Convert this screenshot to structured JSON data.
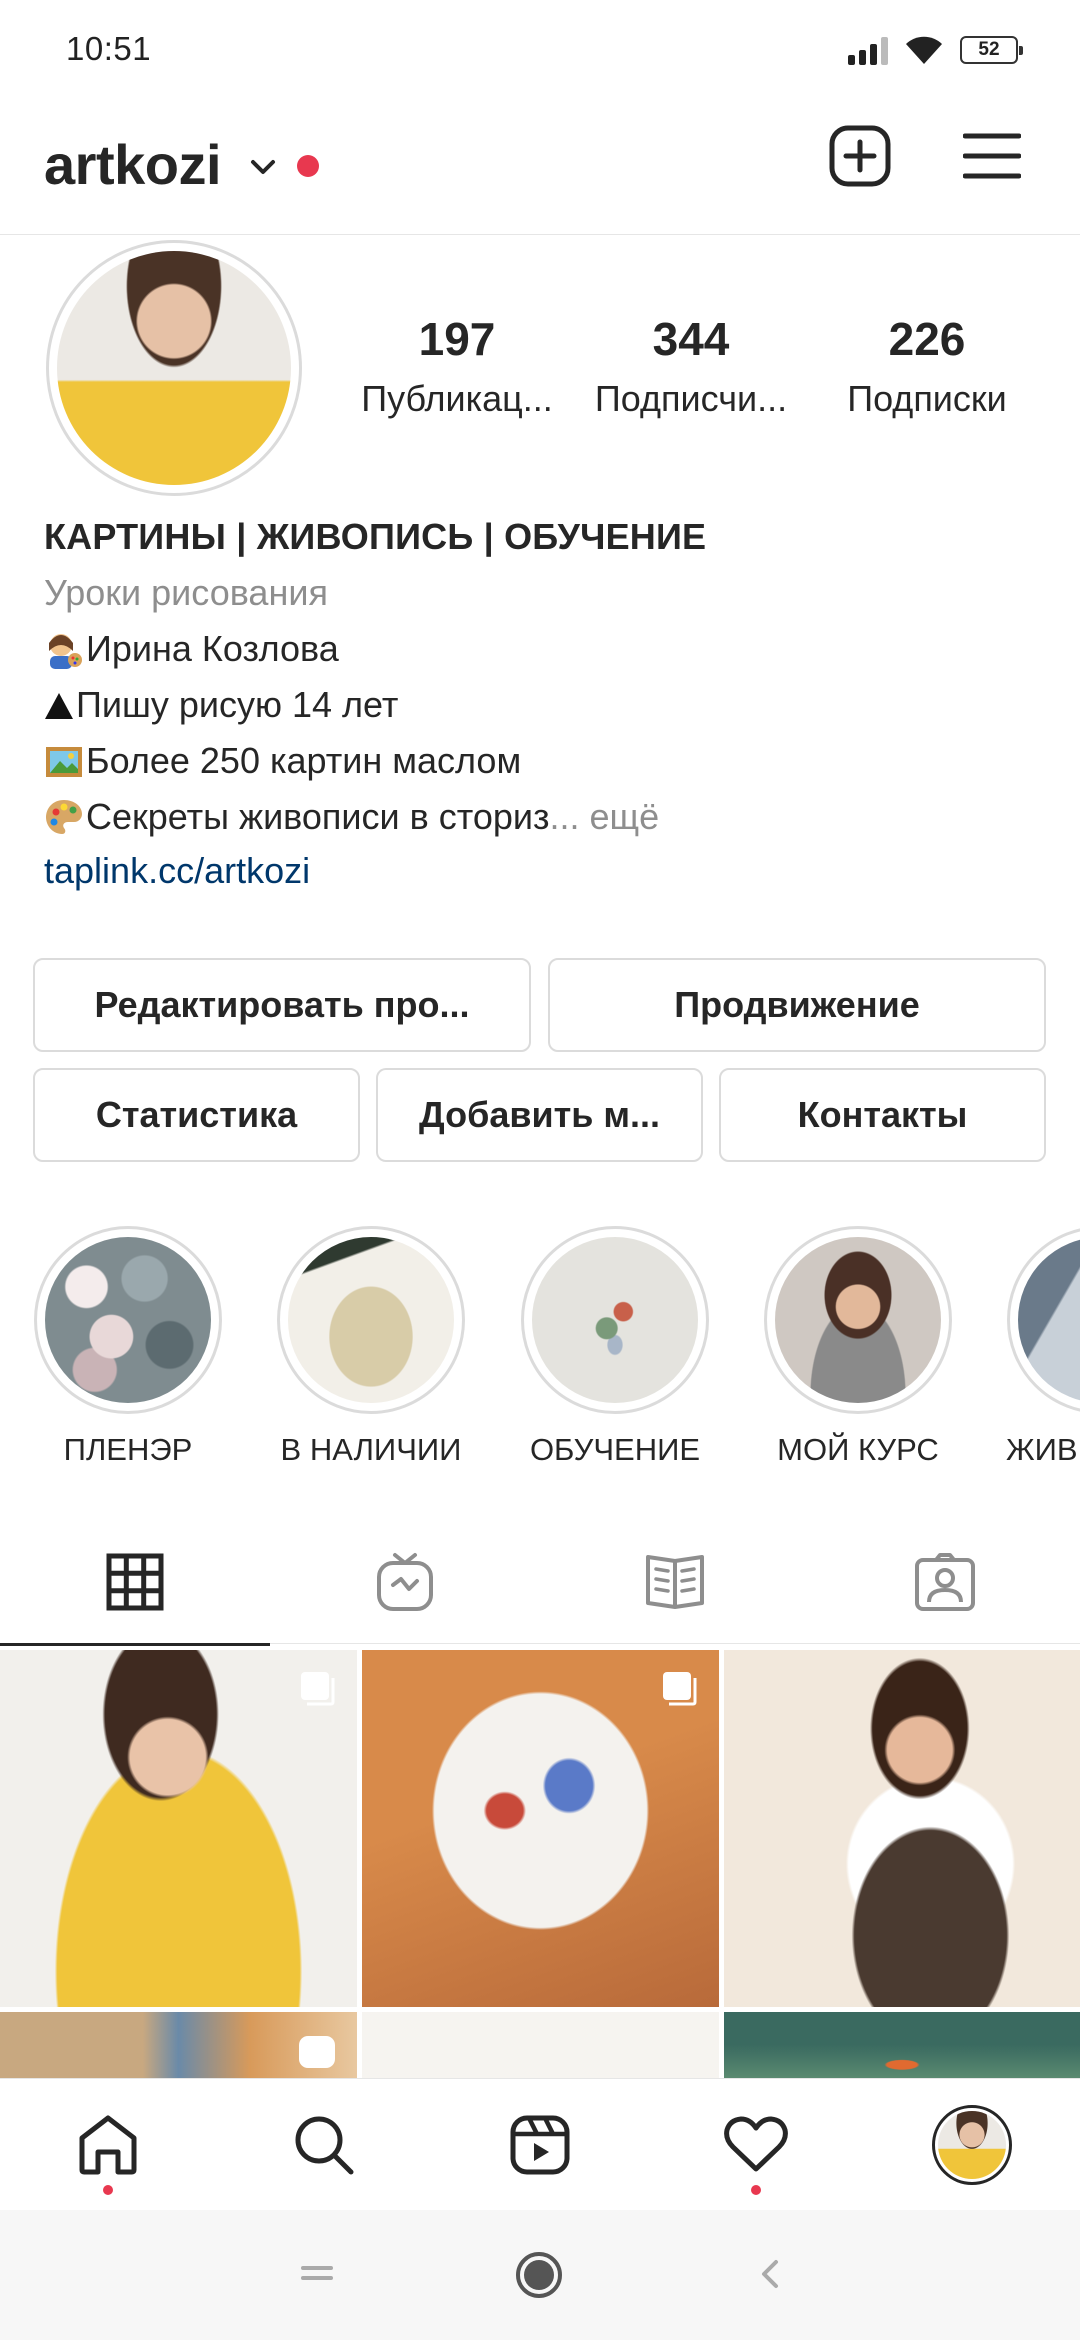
{
  "status_bar": {
    "time": "10:51",
    "battery": "52"
  },
  "header": {
    "username": "artkozi"
  },
  "profile": {
    "stats": [
      {
        "value": "197",
        "label": "Публикац..."
      },
      {
        "value": "344",
        "label": "Подписчи..."
      },
      {
        "value": "226",
        "label": "Подписки"
      }
    ],
    "bio": {
      "title": "КАРТИНЫ | ЖИВОПИСЬ | ОБУЧЕНИЕ",
      "category": "Уроки рисования",
      "line1": "Ирина Козлова",
      "line2": "Пишу рисую 14 лет",
      "line3": "Более 250 картин маслом",
      "line4": "Секреты живописи в сториз",
      "more": "... ещё",
      "link": "taplink.cc/artkozi"
    }
  },
  "buttons": {
    "edit_profile": "Редактировать про...",
    "promotion": "Продвижение",
    "statistics": "Статистика",
    "add": "Добавить м...",
    "contacts": "Контакты"
  },
  "highlights": [
    {
      "label": "ПЛЕНЭР"
    },
    {
      "label": "В НАЛИЧИИ"
    },
    {
      "label": "ОБУЧЕНИЕ"
    },
    {
      "label": "МОЙ КУРС"
    },
    {
      "label": "ЖИВ"
    }
  ],
  "tabs": [
    {
      "icon": "grid-icon",
      "active": true
    },
    {
      "icon": "igtv-icon",
      "active": false
    },
    {
      "icon": "guides-icon",
      "active": false
    },
    {
      "icon": "tagged-icon",
      "active": false
    }
  ],
  "bottom_nav": [
    {
      "icon": "home-icon",
      "badge": true
    },
    {
      "icon": "search-icon",
      "badge": false
    },
    {
      "icon": "reels-icon",
      "badge": false
    },
    {
      "icon": "heart-icon",
      "badge": true
    },
    {
      "icon": "profile-avatar",
      "badge": false
    }
  ],
  "colors": {
    "notification": "#e8384f",
    "link": "#00376b",
    "muted": "#8e8e8e",
    "border": "#dbdbdb"
  }
}
